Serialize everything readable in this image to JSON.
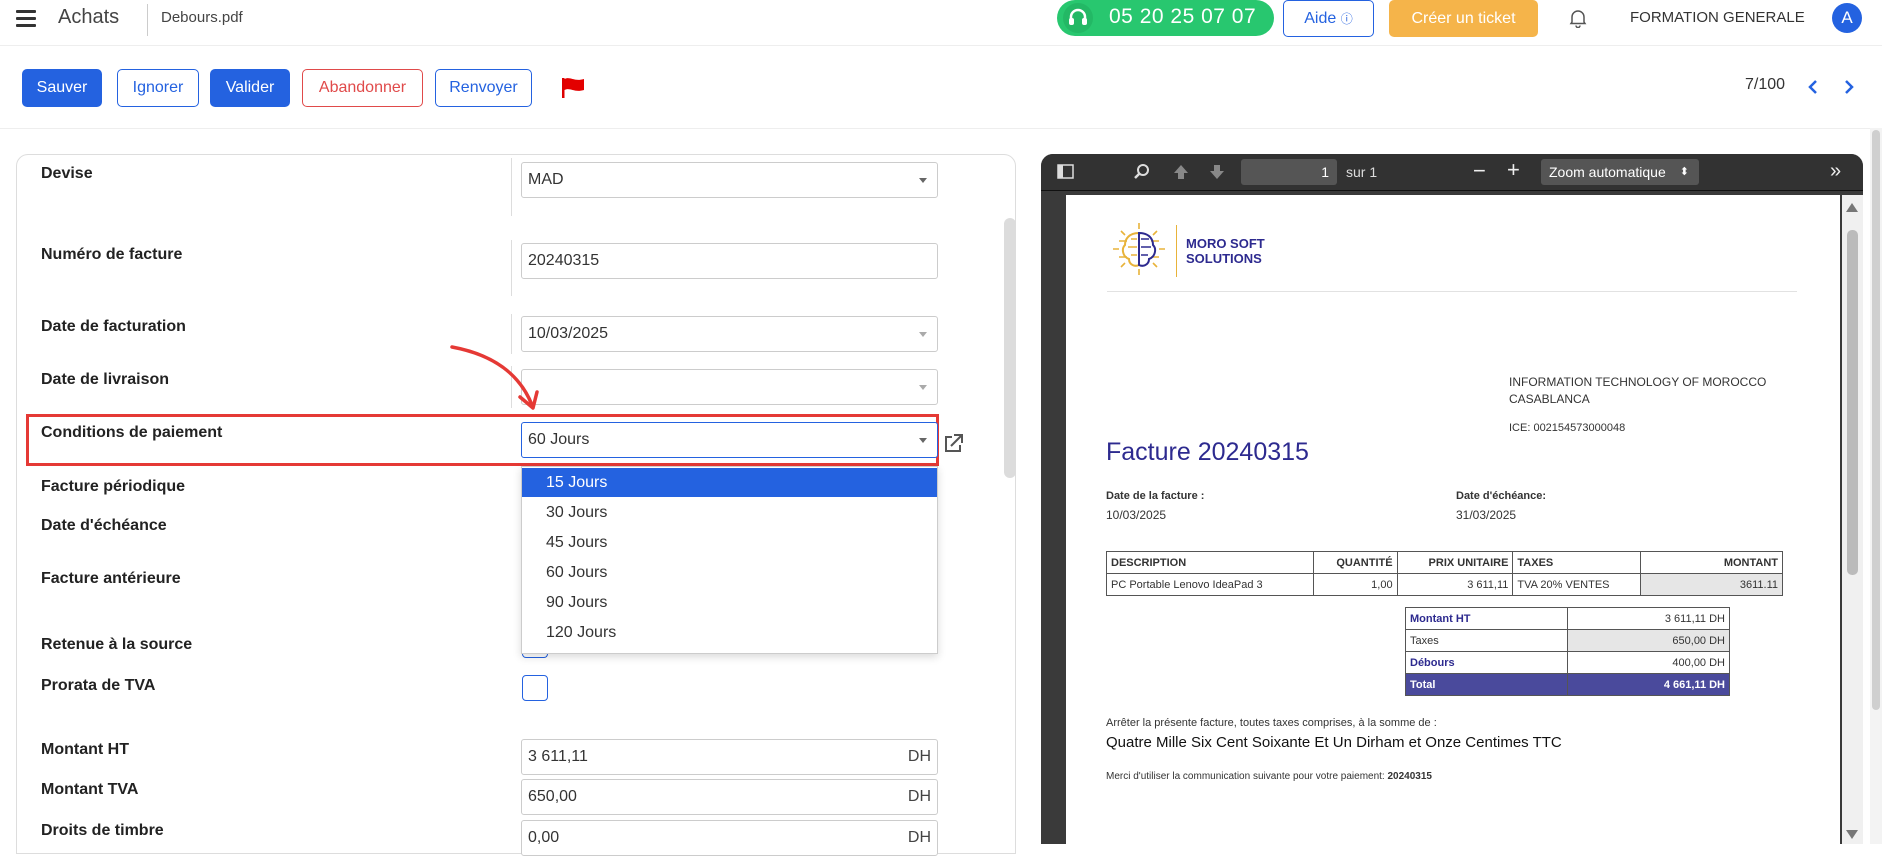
{
  "topbar": {
    "app_title": "Achats",
    "file_name": "Debours.pdf",
    "phone": "05 20 25 07 07",
    "help_label": "Aide",
    "ticket_label": "Créer un ticket",
    "org_name": "FORMATION GENERALE",
    "avatar_initial": "A"
  },
  "actions": {
    "save": "Sauver",
    "ignore": "Ignorer",
    "validate": "Valider",
    "abandon": "Abandonner",
    "resend": "Renvoyer",
    "pager": "7/100"
  },
  "form": {
    "devise_label": "Devise",
    "devise_value": "MAD",
    "invoice_number_label": "Numéro de facture",
    "invoice_number_value": "20240315",
    "invoice_date_label": "Date de facturation",
    "invoice_date_value": "10/03/2025",
    "delivery_date_label": "Date de livraison",
    "delivery_date_value": "",
    "payment_terms_label": "Conditions de paiement",
    "payment_terms_value": "60 Jours",
    "periodic_label": "Facture périodique",
    "due_date_label": "Date d'échéance",
    "previous_invoice_label": "Facture antérieure",
    "withholding_label": "Retenue à la source",
    "vat_prorata_label": "Prorata de TVA",
    "amount_ht_label": "Montant HT",
    "amount_ht_value": "3 611,11",
    "amount_tva_label": "Montant TVA",
    "amount_tva_value": "650,00",
    "stamp_label": "Droits de timbre",
    "stamp_value": "0,00",
    "currency_unit": "DH",
    "payment_options": [
      "15 Jours",
      "30 Jours",
      "45 Jours",
      "60 Jours",
      "90 Jours",
      "120 Jours"
    ],
    "selected_option_index": 0
  },
  "pdf_viewer": {
    "page_input": "1",
    "page_of": "sur 1",
    "zoom": "Zoom automatique"
  },
  "invoice": {
    "logo_line1": "MORO SOFT",
    "logo_line2": "SOLUTIONS",
    "client_name": "INFORMATION TECHNOLOGY OF MOROCCO",
    "client_city": "CASABLANCA",
    "client_ice": "ICE: 002154573000048",
    "title": "Facture 20240315",
    "invoice_date_label": "Date de la facture :",
    "invoice_date": "10/03/2025",
    "due_date_label": "Date d'échéance:",
    "due_date": "31/03/2025",
    "columns": [
      "DESCRIPTION",
      "QUANTITÉ",
      "PRIX UNITAIRE",
      "TAXES",
      "MONTANT"
    ],
    "line": {
      "description": "PC Portable Lenovo IdeaPad 3",
      "quantity": "1,00",
      "unit_price": "3 611,11",
      "taxes": "TVA 20% VENTES",
      "amount": "3611.11"
    },
    "totals": {
      "ht_label": "Montant HT",
      "ht_value": "3 611,11 DH",
      "taxes_label": "Taxes",
      "taxes_value": "650,00 DH",
      "debours_label": "Débours",
      "debours_value": "400,00 DH",
      "total_label": "Total",
      "total_value": "4 661,11 DH"
    },
    "amount_words_intro": "Arrêter la présente facture, toutes taxes comprises, à la somme de :",
    "amount_words": "Quatre Mille Six Cent Soixante Et Un Dirham et Onze Centimes TTC",
    "payment_ref_text": "Merci d'utiliser la communication suivante pour votre paiement:",
    "payment_ref": "20240315"
  },
  "colors": {
    "primary": "#2462e0",
    "phone_green": "#28c76f",
    "ticket_orange": "#f5b44a",
    "danger": "#e04a4a",
    "highlight_red": "#e53935",
    "invoice_navy": "#2d2a8f",
    "total_row": "#4a4a9c"
  }
}
